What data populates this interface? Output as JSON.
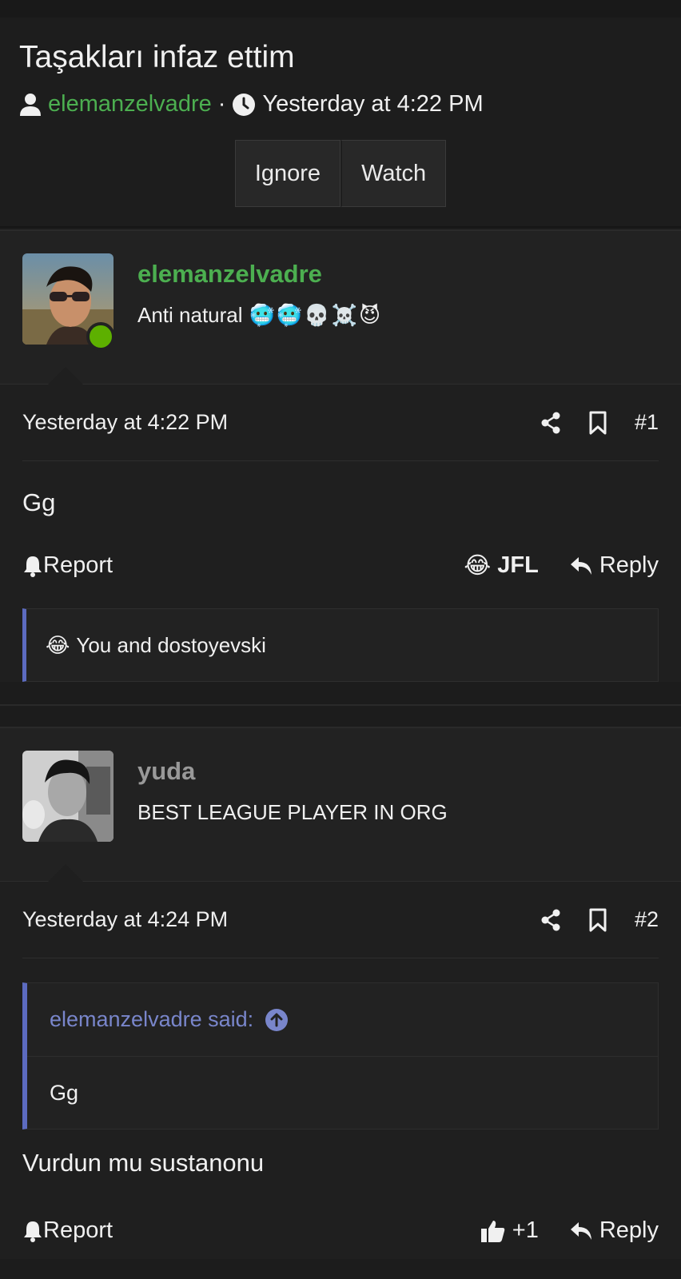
{
  "thread": {
    "title": "Taşakları infaz ettim",
    "author": "elemanzelvadre",
    "separator": "·",
    "time": "Yesterday at 4:22 PM",
    "buttons": {
      "ignore": "Ignore",
      "watch": "Watch"
    }
  },
  "posts": [
    {
      "username": "elemanzelvadre",
      "user_title": "Anti natural",
      "title_emojis": [
        "🥶",
        "🥶",
        "💀",
        "☠️",
        "😈"
      ],
      "date": "Yesterday at 4:22 PM",
      "number": "#1",
      "body": "Gg",
      "report_label": "Report",
      "reaction_emoji": "😂",
      "reaction_label": "JFL",
      "reply_label": "Reply",
      "reaction_summary_emoji": "😂",
      "reaction_summary_text": "You and dostoyevski"
    },
    {
      "username": "yuda",
      "user_title": "BEST LEAGUE PLAYER IN ORG",
      "date": "Yesterday at 4:24 PM",
      "number": "#2",
      "quote_author": "elemanzelvadre said:",
      "quote_body": "Gg",
      "body": "Vurdun mu sustanonu",
      "report_label": "Report",
      "like_label": "+1",
      "reply_label": "Reply"
    }
  ],
  "colors": {
    "accent_green": "#4caf50",
    "quote_blue": "#5c6bc0",
    "online": "#5db000"
  }
}
